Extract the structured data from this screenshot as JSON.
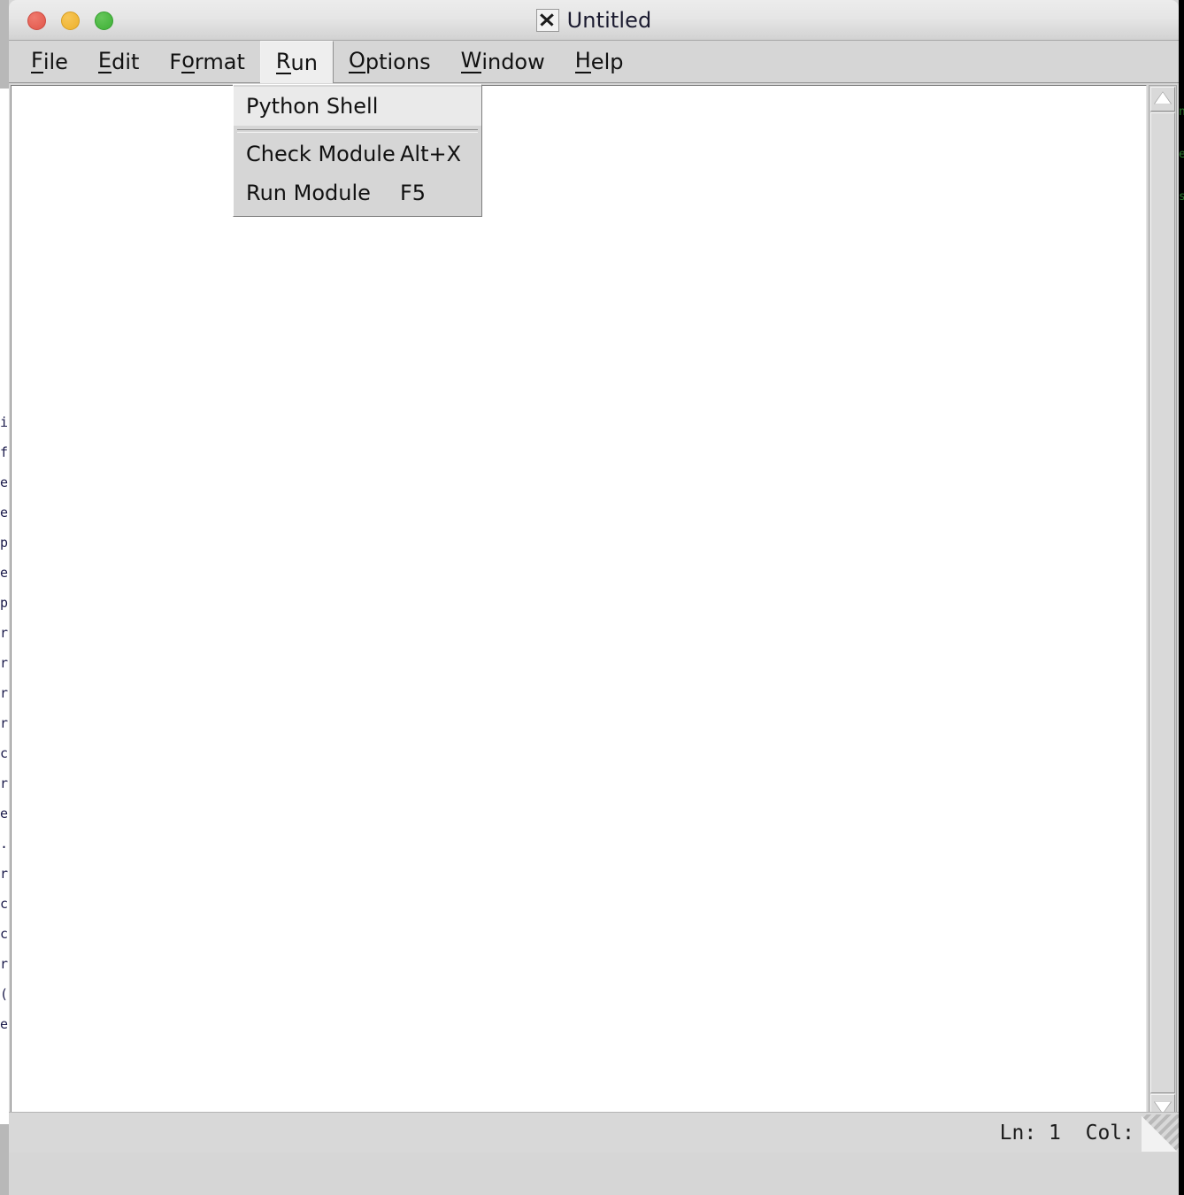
{
  "window": {
    "title": "Untitled",
    "app_icon": "x11-icon",
    "controls": [
      {
        "name": "close",
        "color": "#e0564a"
      },
      {
        "name": "minimize",
        "color": "#edb12c"
      },
      {
        "name": "maximize",
        "color": "#3eb036"
      }
    ]
  },
  "menubar": {
    "items": [
      {
        "key": "file",
        "pre": "",
        "mnemonic": "F",
        "post": "ile",
        "open": false
      },
      {
        "key": "edit",
        "pre": "",
        "mnemonic": "E",
        "post": "dit",
        "open": false
      },
      {
        "key": "format",
        "pre": "F",
        "mnemonic": "o",
        "post": "rmat",
        "open": false
      },
      {
        "key": "run",
        "pre": "",
        "mnemonic": "R",
        "post": "un",
        "open": true
      },
      {
        "key": "options",
        "pre": "",
        "mnemonic": "O",
        "post": "ptions",
        "open": false
      },
      {
        "key": "window",
        "pre": "",
        "mnemonic": "W",
        "post": "indow",
        "open": false
      },
      {
        "key": "help",
        "pre": "",
        "mnemonic": "H",
        "post": "elp",
        "open": false
      }
    ]
  },
  "run_menu": {
    "entries": [
      {
        "type": "item",
        "label": "Python Shell",
        "accel": "",
        "highlighted": true
      },
      {
        "type": "separator"
      },
      {
        "type": "item",
        "label": "Check Module",
        "accel": "Alt+X",
        "highlighted": false
      },
      {
        "type": "item",
        "label": "Run Module",
        "accel": "F5",
        "highlighted": false
      }
    ]
  },
  "editor": {
    "content": "",
    "placeholder": ""
  },
  "scrollbar": {
    "up_arrow_icon": "triangle-up-icon",
    "down_arrow_icon": "triangle-down-icon"
  },
  "statusbar": {
    "text": "Ln: 1  Col:",
    "line": "1",
    "col": "",
    "grip_icon": "resize-grip-icon"
  },
  "colors": {
    "window_bg": "#d6d6d6",
    "titlebar_top": "#ececec",
    "titlebar_bottom": "#cfcfcf",
    "editor_bg": "#ffffff",
    "menu_highlight": "#eaeaea",
    "text": "#111111"
  },
  "background_window": {
    "left_fragments": [
      "i",
      "f",
      "e",
      "e",
      "p",
      "e",
      "p",
      "r",
      "r",
      "r",
      "r",
      "c",
      "r",
      "e",
      ".",
      "r",
      "c",
      "c",
      "r",
      "(",
      "e"
    ],
    "right_fragments": [
      "n",
      "e",
      "s"
    ]
  }
}
